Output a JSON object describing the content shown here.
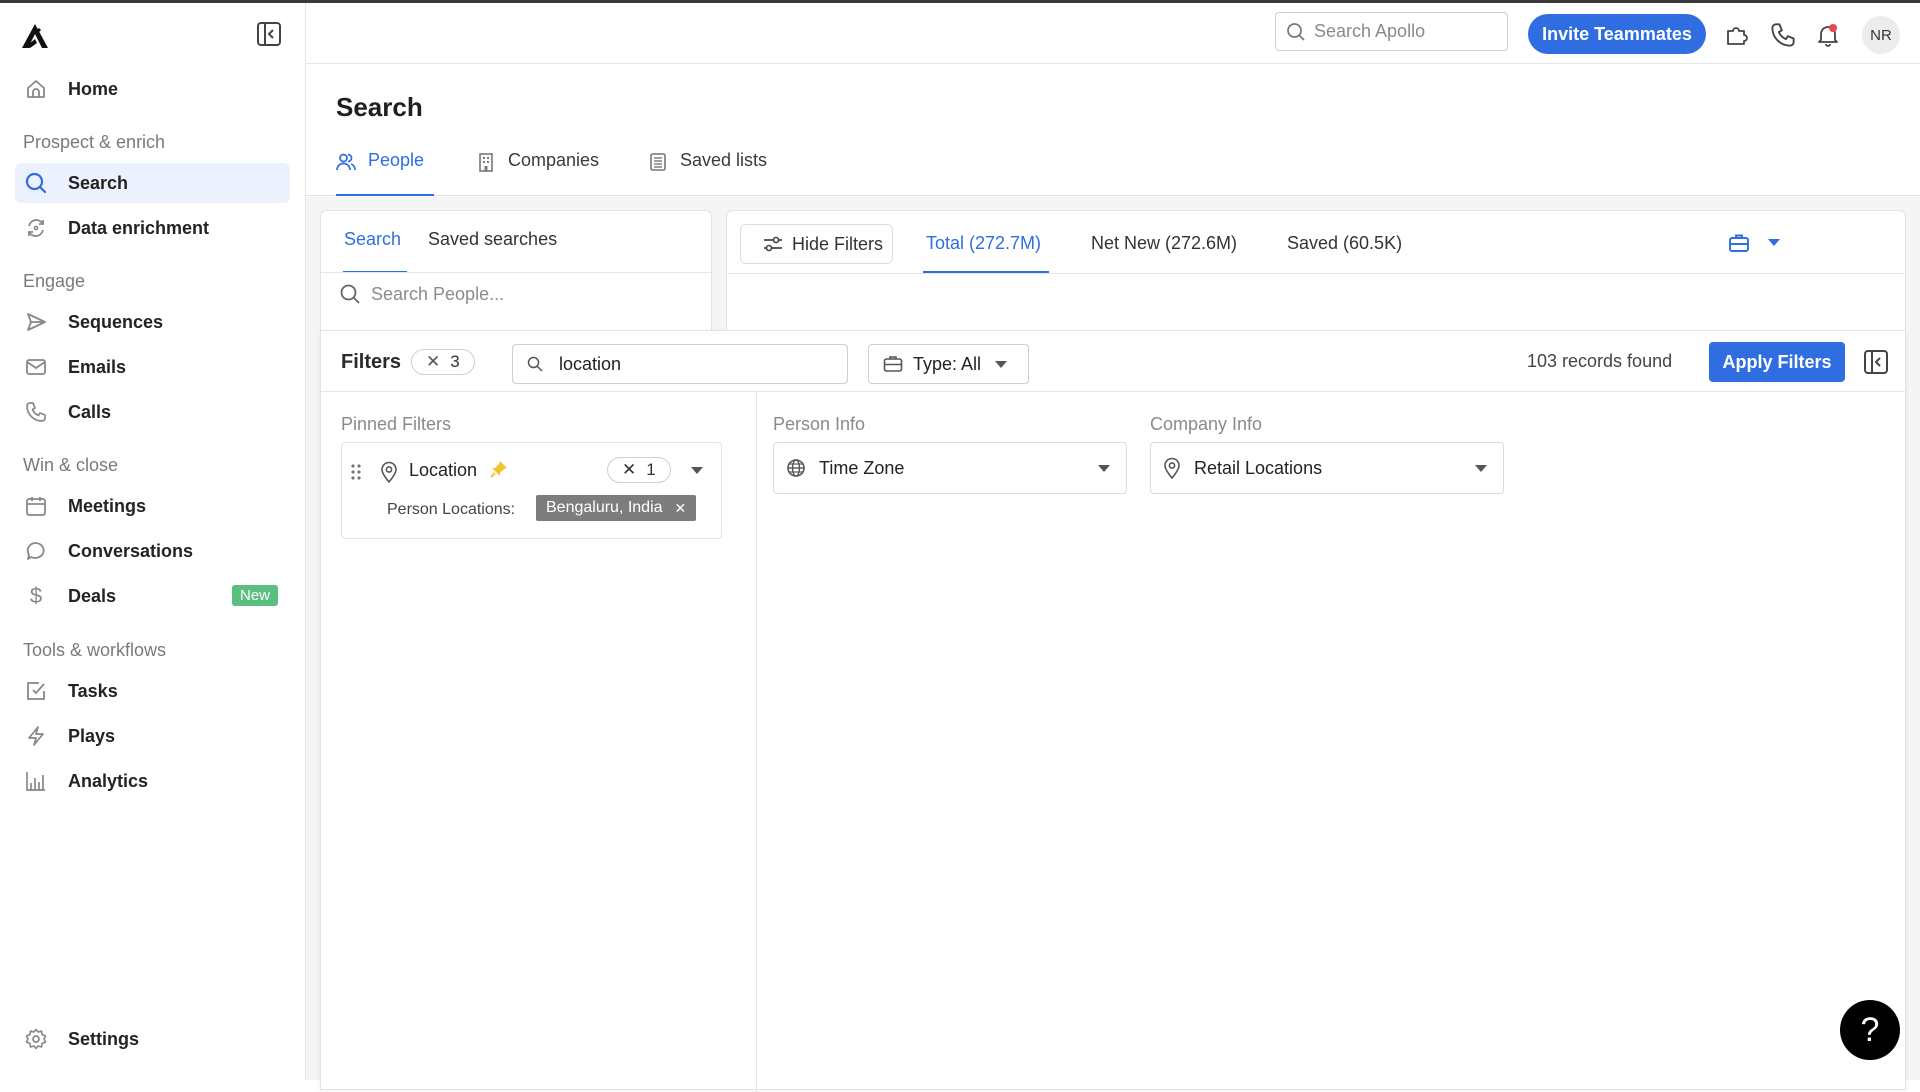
{
  "sidebar": {
    "collapse_label": "Collapse sidebar",
    "home": "Home",
    "sections": [
      {
        "title": "Prospect & enrich",
        "items": [
          {
            "label": "Search",
            "icon": "search-icon",
            "active": true
          },
          {
            "label": "Data enrichment",
            "icon": "refresh-icon"
          }
        ]
      },
      {
        "title": "Engage",
        "items": [
          {
            "label": "Sequences",
            "icon": "send-icon"
          },
          {
            "label": "Emails",
            "icon": "mail-icon"
          },
          {
            "label": "Calls",
            "icon": "phone-icon"
          }
        ]
      },
      {
        "title": "Win & close",
        "items": [
          {
            "label": "Meetings",
            "icon": "calendar-icon"
          },
          {
            "label": "Conversations",
            "icon": "chat-bubble-icon"
          },
          {
            "label": "Deals",
            "icon": "dollar-icon",
            "badge": "New"
          }
        ]
      },
      {
        "title": "Tools & workflows",
        "items": [
          {
            "label": "Tasks",
            "icon": "checkbox-icon"
          },
          {
            "label": "Plays",
            "icon": "lightning-icon"
          },
          {
            "label": "Analytics",
            "icon": "bar-chart-icon"
          }
        ]
      }
    ],
    "settings": "Settings",
    "badge_color": "#5bbf7f"
  },
  "topbar": {
    "search_placeholder": "Search Apollo",
    "invite_label": "Invite Teammates",
    "avatar_initials": "NR",
    "accent": "#2f6de1"
  },
  "page": {
    "title": "Search",
    "tabs": [
      {
        "label": "People",
        "icon": "people-icon",
        "active": true
      },
      {
        "label": "Companies",
        "icon": "building-icon"
      },
      {
        "label": "Saved lists",
        "icon": "list-icon"
      }
    ]
  },
  "left_card": {
    "tabs": [
      {
        "label": "Search",
        "active": true
      },
      {
        "label": "Saved searches"
      }
    ],
    "search_placeholder": "Search People..."
  },
  "results": {
    "hide_filters_label": "Hide Filters",
    "tabs": [
      {
        "label": "Total (272.7M)",
        "active": true
      },
      {
        "label": "Net New (272.6M)"
      },
      {
        "label": "Saved (60.5K)"
      }
    ]
  },
  "filters": {
    "title": "Filters",
    "active_count": "3",
    "search_value": "location",
    "type_label": "Type: All",
    "records_found": "103 records found",
    "apply_label": "Apply Filters",
    "pinned_label": "Pinned Filters",
    "person_info_label": "Person Info",
    "company_info_label": "Company Info",
    "pinned": [
      {
        "title": "Location",
        "count": "1",
        "sub_label": "Person Locations:",
        "values": [
          "Bengaluru, India"
        ]
      }
    ],
    "person_info": [
      {
        "label": "Time Zone",
        "icon": "globe-icon"
      }
    ],
    "company_info": [
      {
        "label": "Retail Locations",
        "icon": "location-pin-icon"
      }
    ]
  },
  "help": {
    "label": "?"
  }
}
